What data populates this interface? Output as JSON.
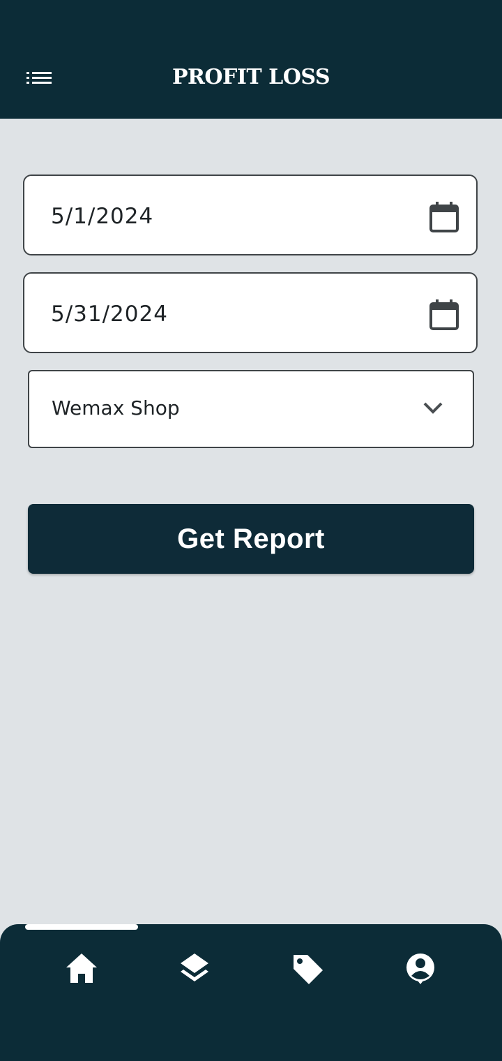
{
  "header": {
    "title": "PROFIT LOSS",
    "menu_icon": "list-menu-icon"
  },
  "form": {
    "start_date": "5/1/2024",
    "end_date": "5/31/2024",
    "calendar_icon": "calendar-icon",
    "shop": {
      "selected": "Wemax Shop",
      "icon": "chevron-down-icon"
    },
    "submit_label": "Get Report"
  },
  "bottom_nav": {
    "items": [
      {
        "icon": "home-icon",
        "active": true
      },
      {
        "icon": "layers-icon",
        "active": false
      },
      {
        "icon": "tag-icon",
        "active": false
      },
      {
        "icon": "account-circle-icon",
        "active": false
      }
    ]
  },
  "colors": {
    "primary": "#0c2c37",
    "background": "#dfe3e6",
    "field_border": "#3f4447"
  }
}
